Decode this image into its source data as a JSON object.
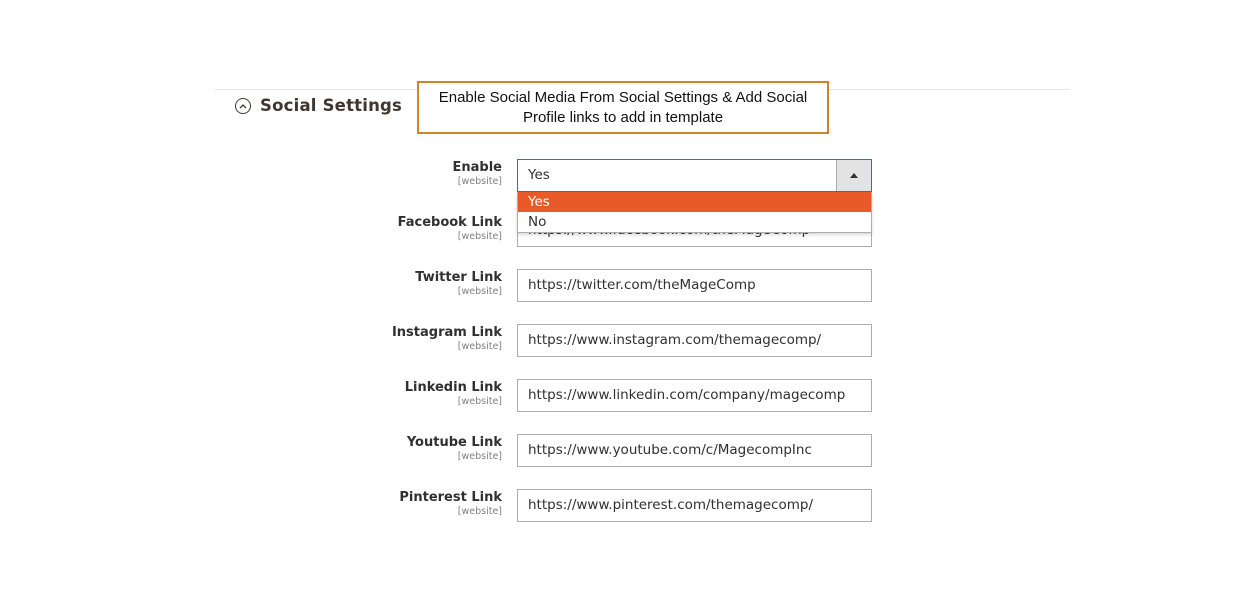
{
  "section": {
    "title": "Social Settings",
    "collapse_icon": "chevron-up-circle-icon"
  },
  "callout": {
    "line1": "Enable Social Media From Social Settings & Add Social",
    "line2": "Profile links to add in template",
    "border_color": "#d0822d"
  },
  "fields": {
    "enable": {
      "label": "Enable",
      "scope": "[website]",
      "value": "Yes",
      "options": [
        "Yes",
        "No"
      ],
      "highlight_color": "#e85a28"
    },
    "facebook": {
      "label": "Facebook Link",
      "scope": "[website]",
      "value": "https://www.facebook.com/theMageComp"
    },
    "twitter": {
      "label": "Twitter Link",
      "scope": "[website]",
      "value": "https://twitter.com/theMageComp"
    },
    "instagram": {
      "label": "Instagram Link",
      "scope": "[website]",
      "value": "https://www.instagram.com/themagecomp/"
    },
    "linkedin": {
      "label": "Linkedin Link",
      "scope": "[website]",
      "value": "https://www.linkedin.com/company/magecomp"
    },
    "youtube": {
      "label": "Youtube Link",
      "scope": "[website]",
      "value": "https://www.youtube.com/c/MagecompInc"
    },
    "pinterest": {
      "label": "Pinterest Link",
      "scope": "[website]",
      "value": "https://www.pinterest.com/themagecomp/"
    }
  }
}
